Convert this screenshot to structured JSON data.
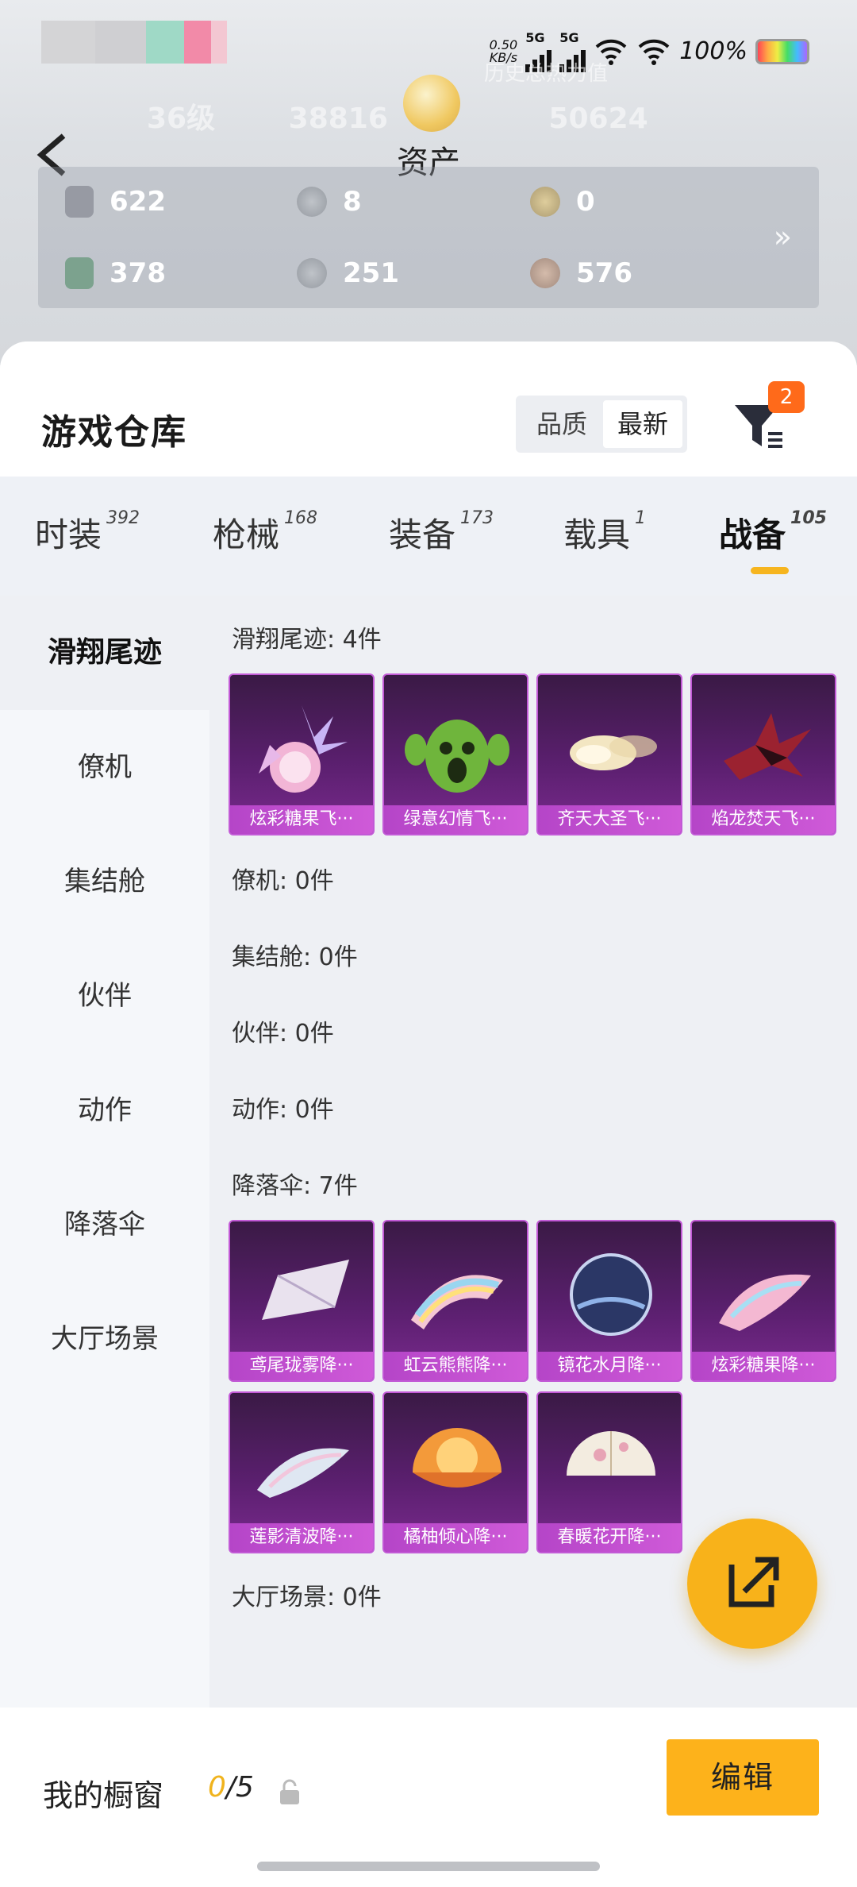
{
  "status": {
    "net_speed": "0.50",
    "net_unit": "KB/s",
    "sim1": "5G",
    "sim2": "5G",
    "battery": "100%"
  },
  "header": {
    "history_label": "历史总热力值",
    "level": "36级",
    "rank_points": "38816",
    "gold_total": "50624",
    "title": "资产",
    "currencies": [
      {
        "icon": "card-icon",
        "value": "622"
      },
      {
        "icon": "coin-icon",
        "value": "8"
      },
      {
        "icon": "gold-coin-icon",
        "value": "0"
      },
      {
        "icon": "ticket-icon",
        "value": "378"
      },
      {
        "icon": "silver-coin-icon",
        "value": "251"
      },
      {
        "icon": "copper-coin-icon",
        "value": "576"
      }
    ],
    "more_glyph": "»"
  },
  "warehouse": {
    "title": "游戏仓库",
    "sort_quality": "品质",
    "sort_latest": "最新",
    "filter_badge": "2"
  },
  "tabs": [
    {
      "label": "时装",
      "count": "392"
    },
    {
      "label": "枪械",
      "count": "168"
    },
    {
      "label": "装备",
      "count": "173"
    },
    {
      "label": "载具",
      "count": "1"
    },
    {
      "label": "战备",
      "count": "105"
    }
  ],
  "sidenav": [
    "滑翔尾迹",
    "僚机",
    "集结舱",
    "伙伴",
    "动作",
    "降落伞",
    "大厅场景"
  ],
  "sections": {
    "glide": "滑翔尾迹: 4件",
    "wingman": "僚机: 0件",
    "pod": "集结舱: 0件",
    "partner": "伙伴: 0件",
    "emote": "动作: 0件",
    "parachute": "降落伞: 7件",
    "lobby": "大厅场景: 0件"
  },
  "glide_items": [
    "炫彩糖果飞···",
    "绿意幻情飞···",
    "齐天大圣飞···",
    "焰龙焚天飞···"
  ],
  "parachute_items": [
    "鸢尾珑雾降···",
    "虹云熊熊降···",
    "镜花水月降···",
    "炫彩糖果降···",
    "莲影清波降···",
    "橘柚倾心降···",
    "春暖花开降···"
  ],
  "bottom": {
    "showcase_label": "我的橱窗",
    "showcase_used": "0",
    "showcase_total": "/5",
    "edit": "编辑"
  },
  "colors": {
    "accent": "#fdb21b",
    "badge": "#ff6a1a",
    "card_purple": "#7a2a8e"
  }
}
